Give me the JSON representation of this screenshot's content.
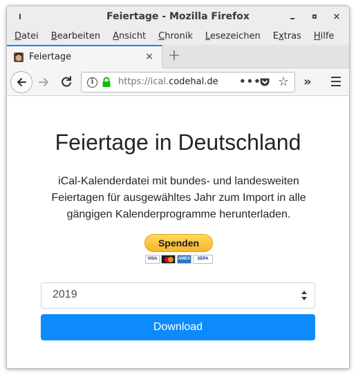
{
  "window": {
    "title": "Feiertage - Mozilla Firefox",
    "close_glyph": "×"
  },
  "menubar": {
    "items": [
      {
        "pre": "",
        "key": "D",
        "post": "atei"
      },
      {
        "pre": "",
        "key": "B",
        "post": "earbeiten"
      },
      {
        "pre": "",
        "key": "A",
        "post": "nsicht"
      },
      {
        "pre": "",
        "key": "C",
        "post": "hronik"
      },
      {
        "pre": "",
        "key": "L",
        "post": "esezeichen"
      },
      {
        "pre": "E",
        "key": "x",
        "post": "tras"
      },
      {
        "pre": "",
        "key": "H",
        "post": "ilfe"
      }
    ]
  },
  "tabs": [
    {
      "title": "Feiertage",
      "active": true,
      "favicon": "portrait-favicon-icon"
    }
  ],
  "tabstrip": {
    "close_glyph": "×",
    "new_tab_glyph": "+"
  },
  "navbar": {
    "url_scheme": "https://ical.",
    "url_host": "codehal.de",
    "info_glyph": "i",
    "more_glyph": "•••",
    "star_glyph": "☆",
    "overflow_glyph": "»",
    "secure_color": "#12bc00"
  },
  "page": {
    "title": "Feiertage in Deutschland",
    "description": "iCal-Kalenderdatei mit bundes- und landesweiten Feiertagen für ausgewähltes Jahr zum Import in alle gängigen Kalenderprogramme herunterladen.",
    "donate_label": "Spenden",
    "payment_cards": [
      "VISA",
      "MC",
      "AMEX",
      "SEPA"
    ],
    "year_selected": "2019",
    "download_label": "Download",
    "accent_color": "#0d8bfd"
  }
}
